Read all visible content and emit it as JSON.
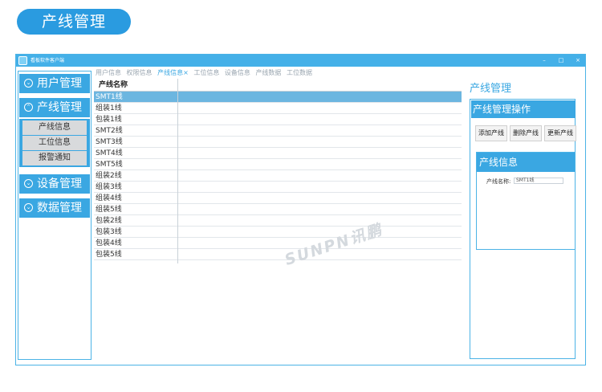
{
  "banner": {
    "title": "产线管理"
  },
  "window": {
    "title": "看板软件客户端",
    "min": "–",
    "max": "□",
    "close": "×"
  },
  "nav": {
    "user_mgmt": "用户管理",
    "line_mgmt": "产线管理",
    "device_mgmt": "设备管理",
    "data_mgmt": "数据管理",
    "subitems": [
      "产线信息",
      "工位信息",
      "报警通知"
    ],
    "icon_collapsed": "⌄",
    "icon_expanded": "⌃"
  },
  "tabs": [
    "用户信息",
    "权限信息",
    "产线信息",
    "工位信息",
    "设备信息",
    "产线数据",
    "工位数据"
  ],
  "tab_active_marker": "×",
  "grid": {
    "column": "产线名称",
    "rows": [
      "SMT1线",
      "组装1线",
      "包装1线",
      "SMT2线",
      "SMT3线",
      "SMT4线",
      "SMT5线",
      "组装2线",
      "组装3线",
      "组装4线",
      "组装5线",
      "包装2线",
      "包装3线",
      "包装4线",
      "包装5线"
    ]
  },
  "watermark": "SUNPN讯鹏",
  "right": {
    "title": "产线管理",
    "ops_title": "产线管理操作",
    "btn_add": "添加产线",
    "btn_delete": "删除产线",
    "btn_update": "更新产线",
    "info_title": "产线信息",
    "name_label": "产线名称:",
    "name_value": "SMT1线"
  },
  "colors": {
    "accent": "#3aa7e2",
    "selected_row": "#6cb6e0",
    "banner": "#2a9be0"
  }
}
